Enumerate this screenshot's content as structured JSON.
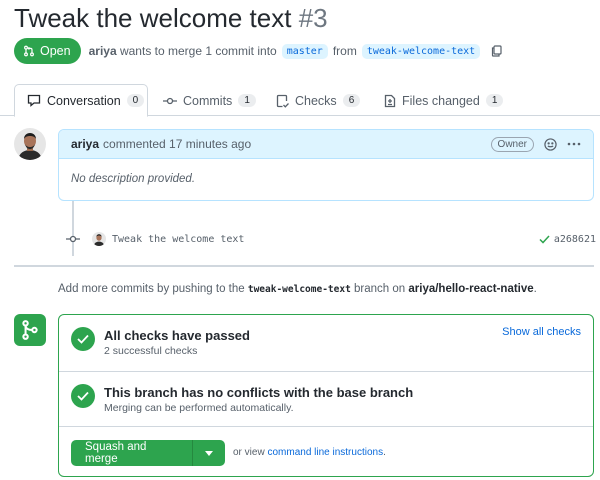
{
  "pr": {
    "title": "Tweak the welcome text",
    "number": "#3",
    "state": "Open",
    "author": "ariya",
    "merge_text": "wants to merge 1 commit into",
    "base_branch": "master",
    "from_text": "from",
    "head_branch": "tweak-welcome-text"
  },
  "tabs": [
    {
      "label": "Conversation",
      "count": "0"
    },
    {
      "label": "Commits",
      "count": "1"
    },
    {
      "label": "Checks",
      "count": "6"
    },
    {
      "label": "Files changed",
      "count": "1"
    }
  ],
  "comment": {
    "author": "ariya",
    "meta": "commented 17 minutes ago",
    "badge": "Owner",
    "body": "No description provided."
  },
  "commit": {
    "message": "Tweak the welcome text",
    "sha": "a268621"
  },
  "push_note": {
    "prefix": "Add more commits by pushing to the",
    "branch": "tweak-welcome-text",
    "middle": "branch on",
    "repo": "ariya/hello-react-native",
    "suffix": "."
  },
  "merge": {
    "checks_title": "All checks have passed",
    "checks_sub": "2 successful checks",
    "show_all": "Show all checks",
    "conflict_title": "This branch has no conflicts with the base branch",
    "conflict_sub": "Merging can be performed automatically.",
    "button": "Squash and merge",
    "or_view": "or view",
    "cli_link": "command line instructions",
    "cli_suffix": "."
  },
  "colors": {
    "accent": "#2da44e",
    "link": "#0969da",
    "header_bg": "#ddf4ff"
  },
  "icons": [
    "git-pull-request-icon",
    "copy-icon",
    "comment-icon",
    "git-commit-icon",
    "checklist-icon",
    "file-diff-icon",
    "smiley-icon",
    "kebab-icon",
    "check-icon",
    "git-merge-icon",
    "triangle-down-icon"
  ]
}
